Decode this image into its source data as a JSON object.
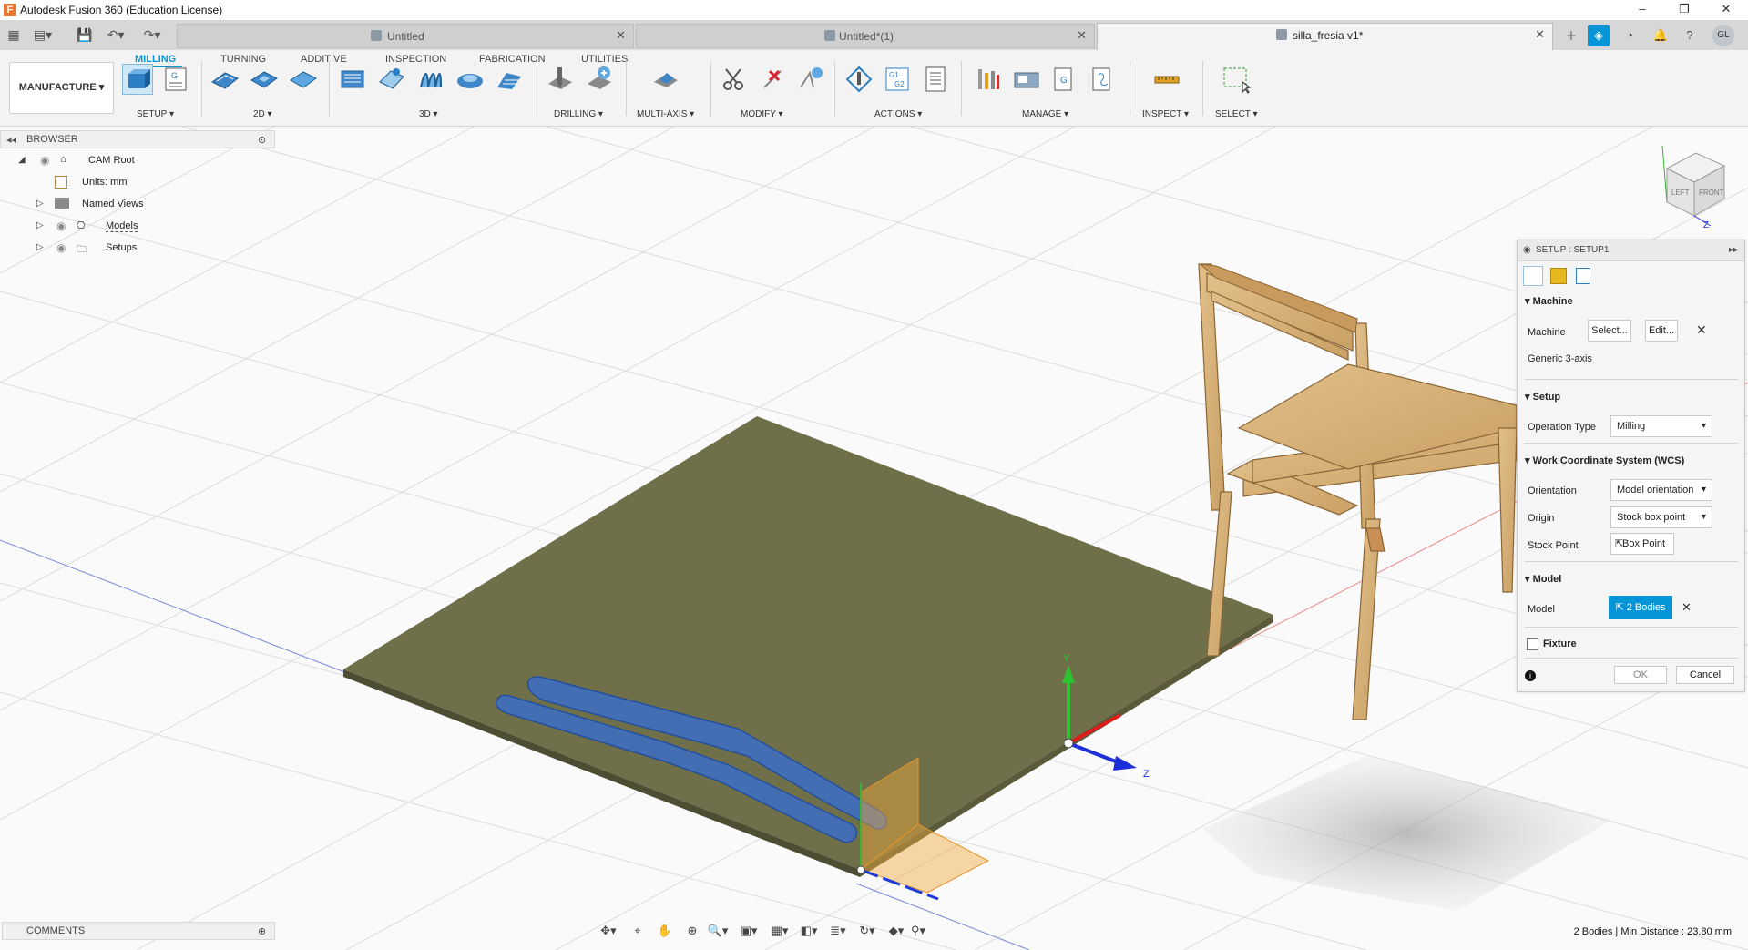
{
  "app": {
    "title": "Autodesk Fusion 360 (Education License)",
    "logo_letter": "F"
  },
  "window_controls": {
    "minimize": "–",
    "restore": "❐",
    "close": "✕"
  },
  "tabs": [
    {
      "label": "Untitled",
      "active": false
    },
    {
      "label": "Untitled*(1)",
      "active": false
    },
    {
      "label": "silla_fresia v1*",
      "active": true
    }
  ],
  "user_initials": "GL",
  "ribbon": {
    "workspace": "MANUFACTURE ▾",
    "tabs": [
      "MILLING",
      "TURNING",
      "ADDITIVE",
      "INSPECTION",
      "FABRICATION",
      "UTILITIES"
    ],
    "active_tab": "MILLING",
    "groups": [
      "SETUP ▾",
      "2D ▾",
      "3D ▾",
      "DRILLING ▾",
      "MULTI-AXIS ▾",
      "MODIFY ▾",
      "ACTIONS ▾",
      "MANAGE ▾",
      "INSPECT ▾",
      "SELECT ▾"
    ]
  },
  "browser": {
    "title": "BROWSER",
    "items": [
      {
        "label": "CAM Root"
      },
      {
        "label": "Units: mm"
      },
      {
        "label": "Named Views"
      },
      {
        "label": "Models"
      },
      {
        "label": "Setups"
      }
    ]
  },
  "comments": {
    "title": "COMMENTS"
  },
  "viewcube": {
    "left": "LEFT",
    "front": "FRONT",
    "axis_z": "Z"
  },
  "axes": {
    "y": "Y",
    "z": "Z"
  },
  "setup_dialog": {
    "title": "SETUP : SETUP1",
    "machine_section": "Machine",
    "machine_label": "Machine",
    "select_button": "Select...",
    "edit_button": "Edit...",
    "machine_value": "Generic 3-axis",
    "setup_section": "Setup",
    "operation_type_label": "Operation Type",
    "operation_type_value": "Milling",
    "wcs_section": "Work Coordinate System (WCS)",
    "orientation_label": "Orientation",
    "orientation_value": "Model orientation",
    "origin_label": "Origin",
    "origin_value": "Stock box point",
    "stock_point_label": "Stock Point",
    "stock_point_value": "Box Point",
    "model_section": "Model",
    "model_label": "Model",
    "model_value": "2 Bodies",
    "fixture_section": "Fixture",
    "ok_button": "OK",
    "cancel_button": "Cancel"
  },
  "status": {
    "text": "2 Bodies | Min Distance : 23.80 mm"
  },
  "colors": {
    "accent": "#0696d7",
    "stock": "#6f6f4a",
    "parts": "#3d6fc7",
    "chair": "#d9b47a"
  }
}
